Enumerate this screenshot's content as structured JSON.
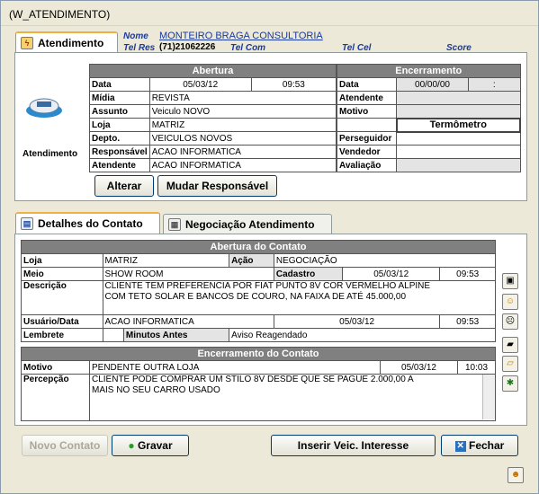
{
  "window": {
    "title": "(W_ATENDIMENTO)"
  },
  "top_tab": {
    "label": "Atendimento"
  },
  "customer": {
    "nome_label": "Nome",
    "nome": "MONTEIRO BRAGA CONSULTORIA",
    "telres_label": "Tel Res",
    "telres": "(71)21062226",
    "telcom_label": "Tel Com",
    "telcel_label": "Tel Cel",
    "score_label": "Score"
  },
  "atendimento_label": "Atendimento",
  "abertura": {
    "header": "Abertura",
    "data_label": "Data",
    "data": "05/03/12",
    "hora": "09:53",
    "midia_label": "Mídia",
    "midia": "REVISTA",
    "assunto_label": "Assunto",
    "assunto": "Veiculo NOVO",
    "loja_label": "Loja",
    "loja": "MATRIZ",
    "depto_label": "Depto.",
    "depto": "VEICULOS NOVOS",
    "resp_label": "Responsável",
    "resp": "ACAO INFORMATICA",
    "atendente_label": "Atendente",
    "atendente": "ACAO INFORMATICA"
  },
  "encerramento": {
    "header": "Encerramento",
    "data_label": "Data",
    "data": "00/00/00",
    "hora": ":",
    "atendente_label": "Atendente",
    "motivo_label": "Motivo"
  },
  "termometro": {
    "header": "Termômetro",
    "perseguidor_label": "Perseguidor",
    "vendedor_label": "Vendedor",
    "avaliacao_label": "Avaliação"
  },
  "buttons": {
    "alterar": "Alterar",
    "mudar": "Mudar Responsável",
    "novo": "Novo Contato",
    "gravar": "Gravar",
    "inserir": "Inserir Veic. Interesse",
    "fechar": "Fechar"
  },
  "tabs": [
    {
      "label": "Detalhes do Contato"
    },
    {
      "label": "Negociação Atendimento"
    }
  ],
  "contato": {
    "header": "Abertura do Contato",
    "loja_label": "Loja",
    "loja": "MATRIZ",
    "acao_label": "Ação",
    "acao": "NEGOCIAÇÃO",
    "meio_label": "Meio",
    "meio": "SHOW ROOM",
    "cadastro_label": "Cadastro",
    "cadastro_data": "05/03/12",
    "cadastro_hora": "09:53",
    "descricao_label": "Descrição",
    "descricao1": "CLIENTE TEM PREFERENCIA POR FIAT PUNTO 8V COR VERMELHO ALPINE",
    "descricao2": "COM TETO SOLAR E BANCOS DE COURO, NA FAIXA DE ATÉ 45.000,00",
    "usuario_label": "Usuário/Data",
    "usuario": "ACAO INFORMATICA",
    "usuario_data": "05/03/12",
    "usuario_hora": "09:53",
    "lembrete_label": "Lembrete",
    "minutos_label": "Minutos Antes",
    "minutos": "Aviso Reagendado"
  },
  "enc_contato": {
    "header": "Encerramento do Contato",
    "motivo_label": "Motivo",
    "motivo": "PENDENTE OUTRA LOJA",
    "data": "05/03/12",
    "hora": "10:03",
    "percepcao_label": "Percepção",
    "percepcao1": "CLIENTE PODE COMPRAR UM STILO 8V DESDE QUE SE PAGUE 2.000,00 A",
    "percepcao2": "MAIS NO SEU CARRO USADO"
  }
}
